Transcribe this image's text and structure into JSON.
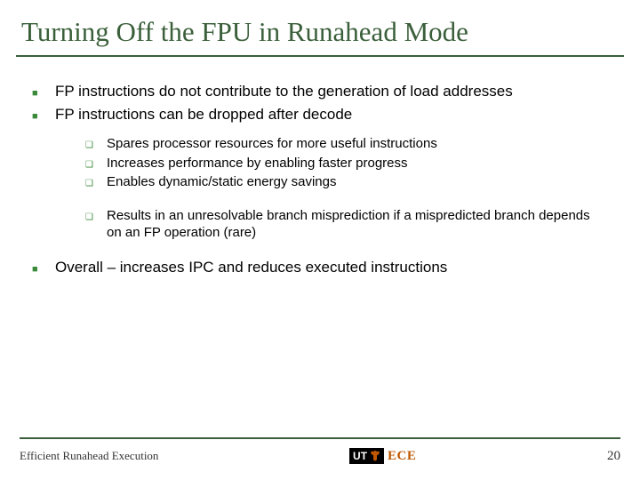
{
  "title": "Turning Off the FPU in Runahead Mode",
  "bullets": {
    "b1": "FP instructions do not contribute to the generation of load addresses",
    "b2": "FP instructions can be dropped after decode",
    "sub1": "Spares processor resources for more useful instructions",
    "sub2": "Increases performance by enabling faster progress",
    "sub3": "Enables dynamic/static energy savings",
    "sub4": "Results in an unresolvable branch misprediction if a mispredicted branch depends on an FP operation (rare)",
    "b3": "Overall – increases IPC and reduces executed instructions"
  },
  "footer": {
    "text": "Efficient Runahead Execution",
    "page": "20",
    "logo_ut": "UT",
    "logo_ece": "ECE"
  }
}
